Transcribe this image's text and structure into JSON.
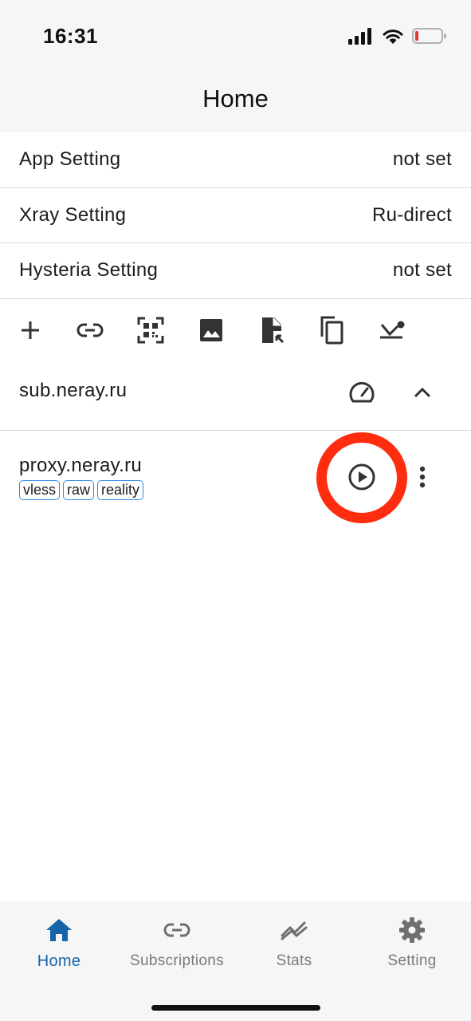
{
  "status_bar": {
    "time": "16:31",
    "battery_color": "#e53935"
  },
  "nav": {
    "title": "Home"
  },
  "settings": [
    {
      "label": "App Setting",
      "value": "not set"
    },
    {
      "label": "Xray Setting",
      "value": "Ru-direct"
    },
    {
      "label": "Hysteria Setting",
      "value": "not set"
    }
  ],
  "toolbar": {
    "icons": [
      "add-icon",
      "link-icon",
      "qr-code-icon",
      "image-icon",
      "file-import-icon",
      "copy-icon",
      "sort-icon"
    ]
  },
  "subscription_group": {
    "title": "sub.neray.ru"
  },
  "proxy": {
    "name": "proxy.neray.ru",
    "tags": [
      "vless",
      "raw",
      "reality"
    ]
  },
  "tabs": [
    {
      "label": "Home",
      "icon": "home-icon",
      "active": true
    },
    {
      "label": "Subscriptions",
      "icon": "link-icon",
      "active": false
    },
    {
      "label": "Stats",
      "icon": "stats-icon",
      "active": false
    },
    {
      "label": "Setting",
      "icon": "gear-icon",
      "active": false
    }
  ],
  "colors": {
    "accent": "#1565a8",
    "tag_border": "#2a8be8",
    "highlight": "#ff2d10"
  }
}
